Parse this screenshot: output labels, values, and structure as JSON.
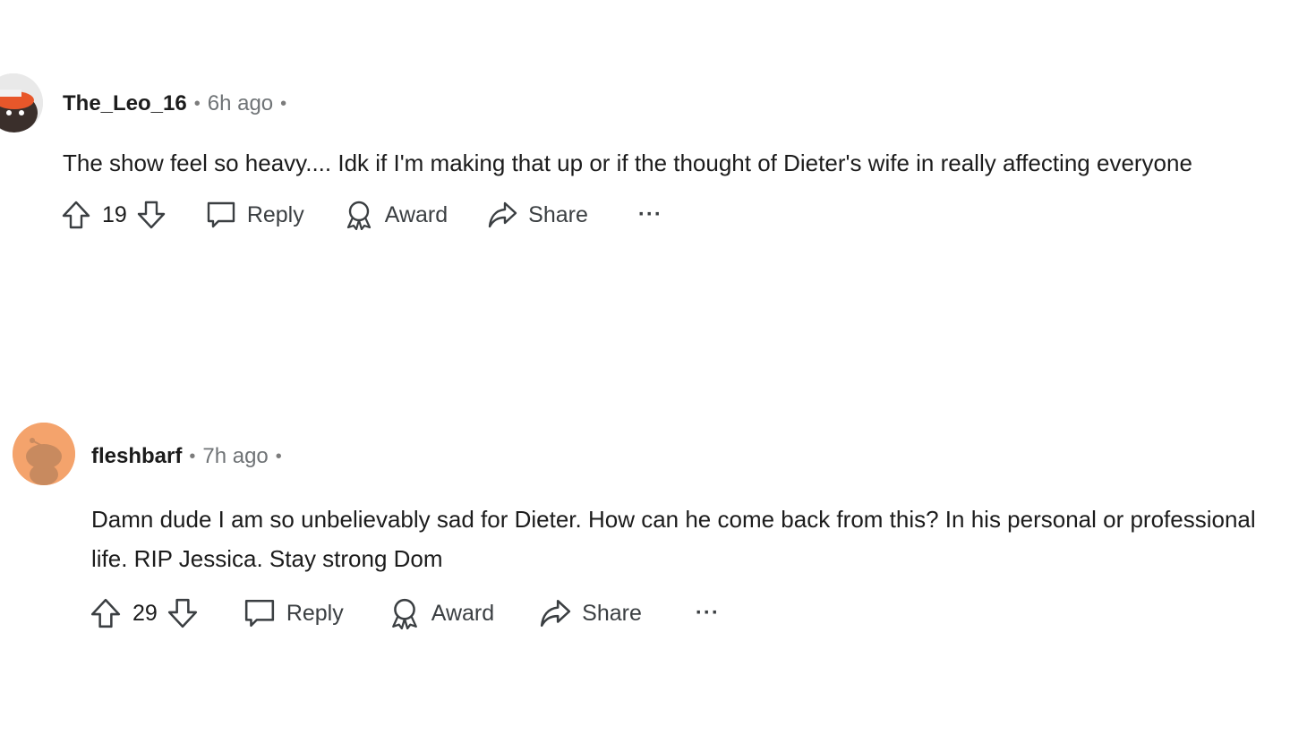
{
  "comments": [
    {
      "username": "The_Leo_16",
      "time": "6h ago",
      "separator": "•",
      "text": "The show feel so heavy.... Idk if I'm making that up or if the thought of Dieter's wife in really affecting everyone",
      "votes": "19",
      "reply_label": "Reply",
      "award_label": "Award",
      "share_label": "Share",
      "more_label": "···",
      "avatar_colors": {
        "bg": "#e9e9e9",
        "hat": "#e8572a",
        "face": "#3a2f2b"
      }
    },
    {
      "username": "fleshbarf",
      "time": "7h ago",
      "separator": "•",
      "text": "Damn dude I am so unbelievably sad for Dieter. How can he come back from this? In his personal or professional life. RIP Jessica. Stay strong Dom",
      "votes": "29",
      "reply_label": "Reply",
      "award_label": "Award",
      "share_label": "Share",
      "more_label": "···",
      "avatar_colors": {
        "bg": "#f4a36c",
        "figure": "#c88a5f"
      }
    }
  ],
  "icons": {
    "upvote": "arrow-up-icon",
    "downvote": "arrow-down-icon",
    "reply": "speech-bubble-icon",
    "award": "award-ribbon-icon",
    "share": "share-arrow-icon",
    "more": "ellipsis-icon"
  }
}
